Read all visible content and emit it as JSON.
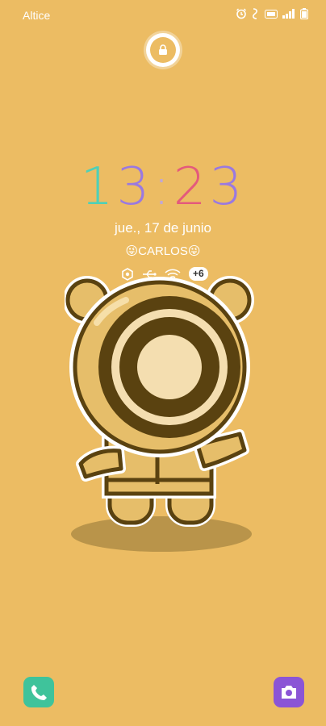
{
  "status": {
    "carrier": "Altice",
    "icons": [
      "alarm-icon",
      "nfc-icon",
      "volte-icon",
      "signal-icon",
      "battery-icon"
    ]
  },
  "lock": {
    "icon": "lock-icon"
  },
  "clock": {
    "digits": [
      "1",
      "3",
      ":",
      "2",
      "3"
    ],
    "colors": [
      "#4FD0B7",
      "#9A79E0",
      "#C0A7D6",
      "#E45A7C",
      "#9A79E0"
    ]
  },
  "date": "jue., 17 de junio",
  "owner": "😜CARLOS😜",
  "notifications": {
    "icons": [
      "settings-icon",
      "usb-icon",
      "wifi-icon"
    ],
    "more": "+6"
  },
  "shortcuts": {
    "left": "phone-icon",
    "right": "camera-icon"
  }
}
